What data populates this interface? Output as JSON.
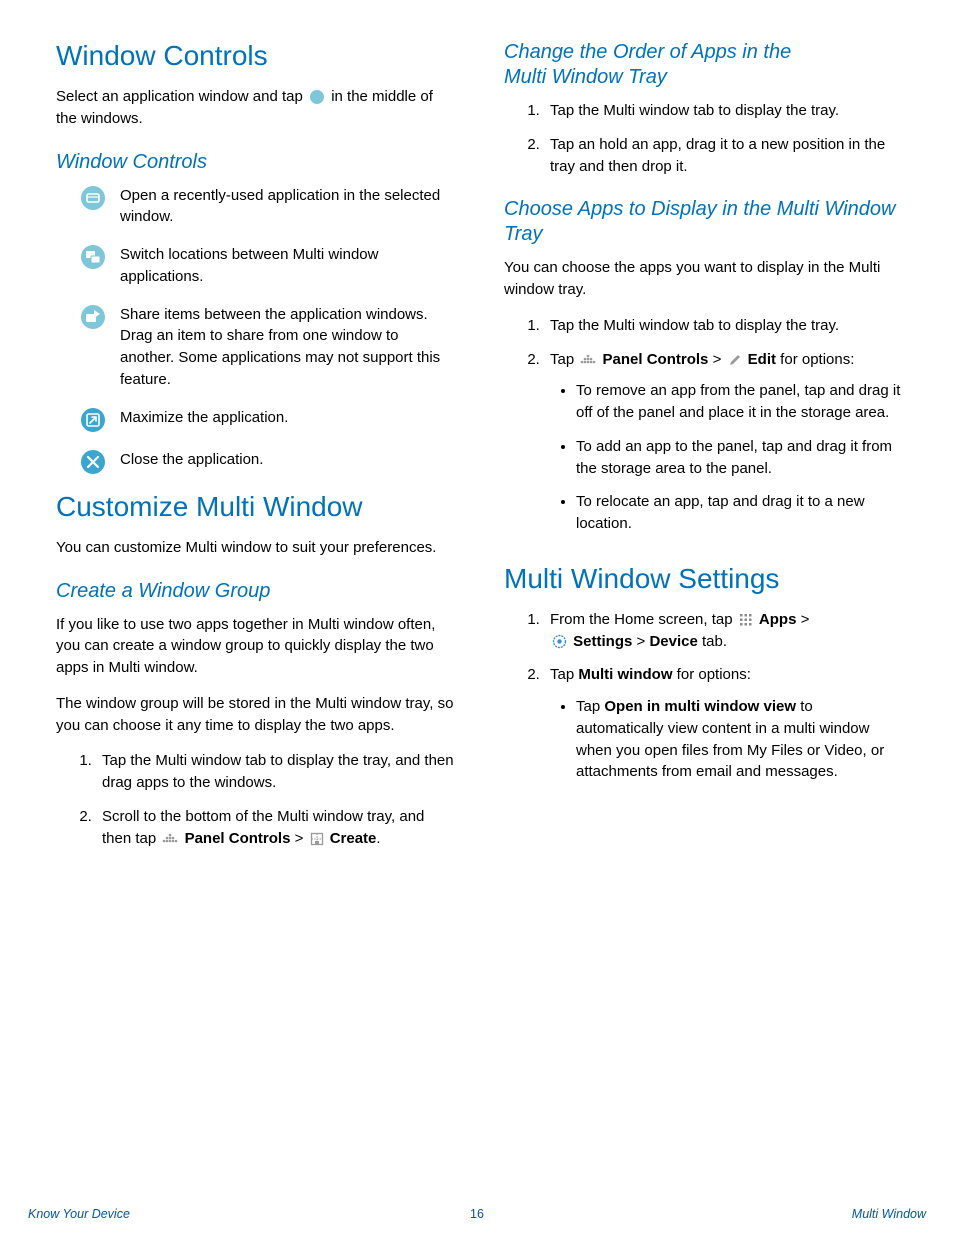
{
  "left": {
    "h1_window_controls": "Window Controls",
    "intro_a": "Select an application window and tap ",
    "intro_b": " in the middle of the windows.",
    "h2_window_controls": "Window Controls",
    "icons": {
      "recent": "Open a recently-used application in the selected window.",
      "switch": "Switch locations between Multi window applications.",
      "share": "Share items between the application windows. Drag an item to share from one window to another. Some applications may not support this feature.",
      "maximize": "Maximize the application.",
      "close": "Close the application."
    },
    "h1_customize": "Customize Multi Window",
    "customize_p": "You can customize Multi window to suit your preferences.",
    "h2_create_group": "Create a Window Group",
    "group_p1": "If you like to use two apps together in Multi window often, you can create a window group to quickly display the two apps in Multi window.",
    "group_p2": "The window group will be stored in the Multi window tray, so you can choose it any time to display the two apps.",
    "group_li1": "Tap the Multi window tab to display the tray, and then drag apps to the windows.",
    "group_li2_a": "Scroll to the bottom of the Multi window tray, and then tap ",
    "group_li2_b": "Panel Controls",
    "group_li2_c": " > ",
    "group_li2_d": "Create",
    "group_li2_e": "."
  },
  "right": {
    "h2_change_order": "Change the Order of Apps in the Multi Window Tray",
    "order_li1": "Tap the Multi window tab to display the tray.",
    "order_li2": "Tap an hold an app, drag it to a new position in the tray and then drop it.",
    "h2_choose_apps": "Choose Apps to Display in the Multi Window Tray",
    "choose_p": "You can choose the apps you want to display in the Multi window tray.",
    "choose_li1": "Tap the Multi window tab to display the tray.",
    "choose_li2_a": "Tap ",
    "choose_li2_b": "Panel Controls",
    "choose_li2_c": " > ",
    "choose_li2_d": "Edit",
    "choose_li2_e": " for options:",
    "choose_sub1": "To remove an app from the panel, tap and drag it off of the panel and place it in the storage area.",
    "choose_sub2": "To add an app to the panel, tap and drag it from the storage area to the panel.",
    "choose_sub3": "To relocate an app, tap and drag it to a new location.",
    "h1_settings": "Multi Window Settings",
    "set_li1_a": "From the Home screen, tap ",
    "set_li1_b": "Apps",
    "set_li1_c": " > ",
    "set_li1_d": "Settings",
    "set_li1_e": " > ",
    "set_li1_f": "Device",
    "set_li1_g": " tab.",
    "set_li2_a": "Tap ",
    "set_li2_b": "Multi window",
    "set_li2_c": " for options:",
    "set_sub1_a": "Tap ",
    "set_sub1_b": "Open in multi window view",
    "set_sub1_c": " to automatically view content in a multi window when you open files from My Files or Video, or attachments from email and messages."
  },
  "footer": {
    "left": "Know Your Device",
    "center": "16",
    "right": "Multi Window"
  }
}
